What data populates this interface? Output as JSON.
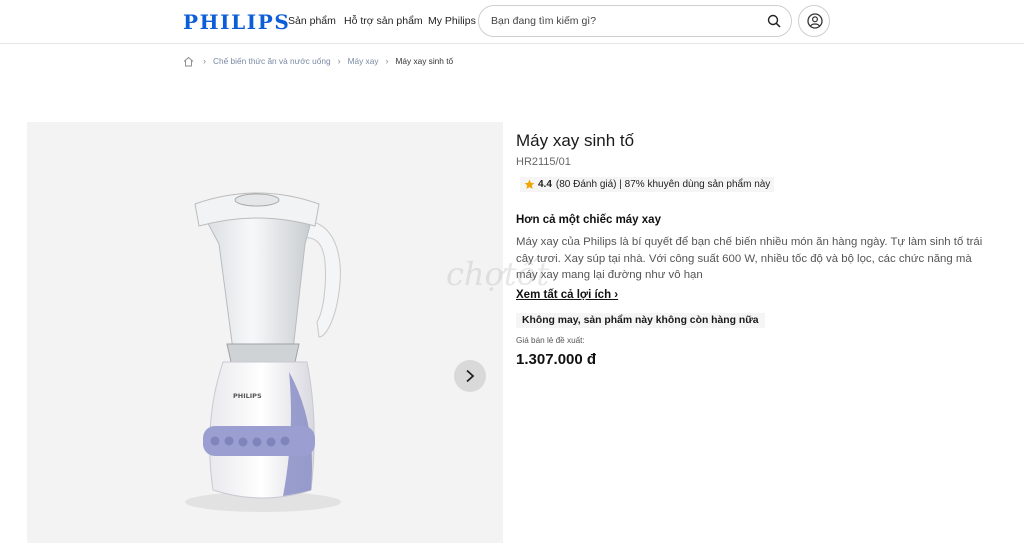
{
  "header": {
    "logo": "PHILIPS",
    "nav": [
      "Sản phẩm",
      "Hỗ trợ sản phẩm",
      "My Philips"
    ],
    "search_placeholder": "Bạn đang tìm kiếm gì?"
  },
  "breadcrumb": {
    "items": [
      "Chế biến thức ăn và nước uống",
      "Máy xay",
      "Máy xay sinh tố"
    ]
  },
  "product": {
    "title": "Máy xay sinh tố",
    "model": "HR2115/01",
    "rating": "4.4",
    "rating_text": "(80 Đánh giá) | 87% khuyên dùng sản phẩm này",
    "section_title": "Hơn cả một chiếc máy xay",
    "description": "Máy xay của Philips là bí quyết để bạn chế biến nhiều món ăn hàng ngày. Tự làm sinh tố trái cây tươi. Xay súp tại nhà. Với công suất 600 W, nhiều tốc độ và bộ lọc, các chức năng mà máy xay mang lại đường như vô hạn",
    "see_all": "Xem tất cả lợi ích ›",
    "unavailable": "Không may, sản phẩm này không còn hàng nữa",
    "price_label": "Giá bán lẻ đề xuất:",
    "price": "1.307.000 đ",
    "image_brand": "PHILIPS"
  },
  "watermark": "chợtốt",
  "colors": {
    "brand": "#0b5ed7",
    "star": "#f0a500",
    "blender_accent": "#8b8fc7"
  },
  "icons": [
    "search-icon",
    "account-icon",
    "home-icon",
    "chevron-right-icon",
    "star-icon"
  ]
}
